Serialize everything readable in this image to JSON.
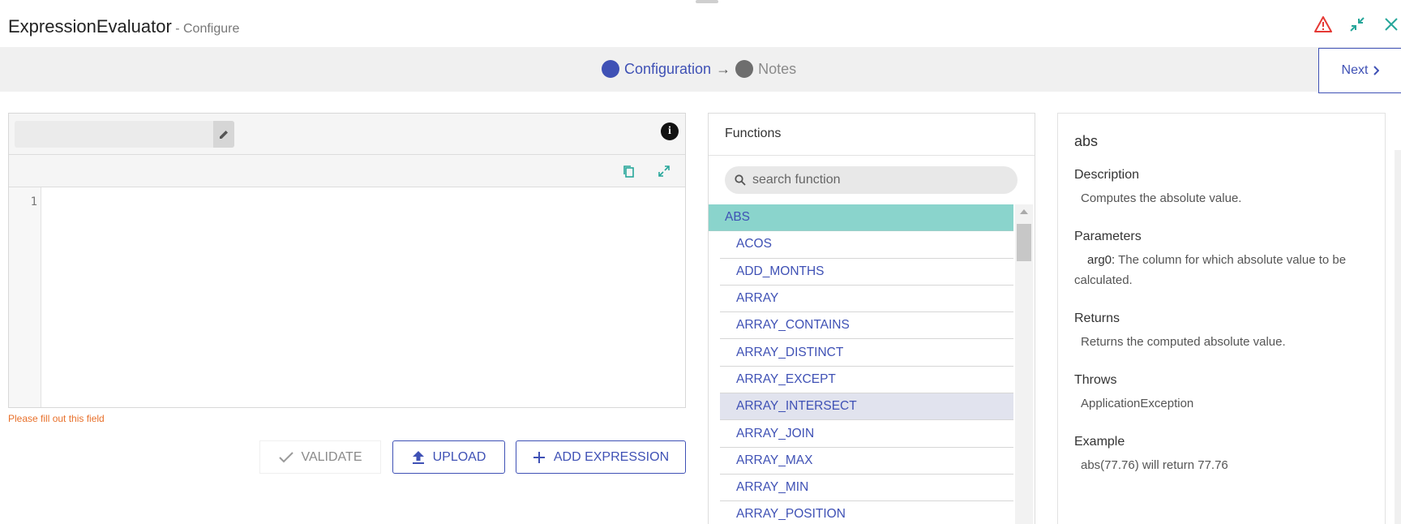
{
  "header": {
    "title": "ExpressionEvaluator",
    "subtitle": " - Configure"
  },
  "steps": [
    {
      "label": "Configuration",
      "active": true
    },
    {
      "label": "Notes",
      "active": false
    }
  ],
  "step_separator": "→",
  "next_label": "Next",
  "editor": {
    "line_number": "1",
    "error": "Please fill out this field"
  },
  "actions": {
    "validate": "VALIDATE",
    "upload": "UPLOAD",
    "add_expression": "ADD EXPRESSION"
  },
  "functions": {
    "title": "Functions",
    "search_placeholder": "search function",
    "items": [
      "ABS",
      "ACOS",
      "ADD_MONTHS",
      "ARRAY",
      "ARRAY_CONTAINS",
      "ARRAY_DISTINCT",
      "ARRAY_EXCEPT",
      "ARRAY_INTERSECT",
      "ARRAY_JOIN",
      "ARRAY_MAX",
      "ARRAY_MIN",
      "ARRAY_POSITION"
    ]
  },
  "details": {
    "name": "abs",
    "description_label": "Description",
    "description": "Computes the absolute value.",
    "parameters_label": "Parameters",
    "param_name": "arg0:",
    "param_desc": " The column for which absolute value to be calculated.",
    "returns_label": "Returns",
    "returns": "Returns the computed absolute value.",
    "throws_label": "Throws",
    "throws": "ApplicationException",
    "example_label": "Example",
    "example": "abs(77.76) will return 77.76"
  },
  "colors": {
    "accent": "#3f51b5",
    "teal": "#26a69a",
    "selected_row": "#8ad4cc",
    "warning": "#e53935",
    "error_text": "#e8702a"
  }
}
